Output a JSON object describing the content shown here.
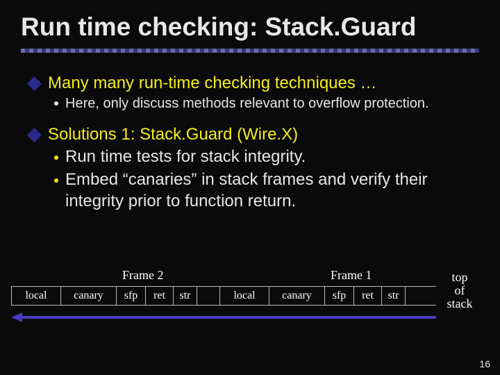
{
  "title": "Run time checking: Stack.Guard",
  "bullets": {
    "b1": "Many many run-time checking techniques …",
    "b1a": "Here, only discuss methods relevant to overflow protection.",
    "b2": "Solutions 1:  Stack.Guard  (Wire.X)",
    "b2a": "Run time tests for stack integrity.",
    "b2b": "Embed “canaries” in stack frames and verify their integrity prior to function return."
  },
  "diagram": {
    "frame2": "Frame 2",
    "frame1": "Frame 1",
    "top_of_stack": "top\nof\nstack",
    "cells": {
      "local": "local",
      "canary": "canary",
      "sfp": "sfp",
      "ret": "ret",
      "str": "str"
    }
  },
  "page": "16"
}
